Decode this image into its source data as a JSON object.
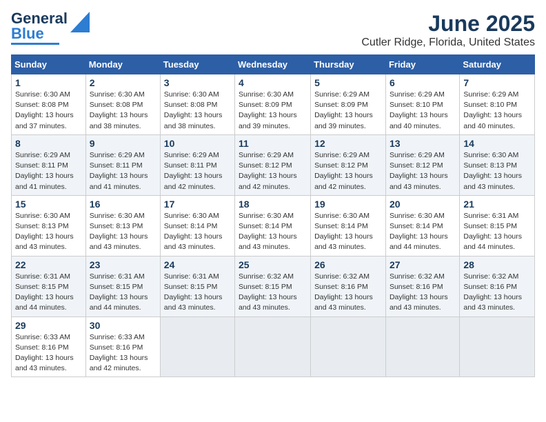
{
  "header": {
    "logo_general": "General",
    "logo_blue": "Blue",
    "month_year": "June 2025",
    "location": "Cutler Ridge, Florida, United States"
  },
  "days_of_week": [
    "Sunday",
    "Monday",
    "Tuesday",
    "Wednesday",
    "Thursday",
    "Friday",
    "Saturday"
  ],
  "weeks": [
    [
      {
        "day": "1",
        "sunrise": "6:30 AM",
        "sunset": "8:08 PM",
        "daylight": "13 hours and 37 minutes."
      },
      {
        "day": "2",
        "sunrise": "6:30 AM",
        "sunset": "8:08 PM",
        "daylight": "13 hours and 38 minutes."
      },
      {
        "day": "3",
        "sunrise": "6:30 AM",
        "sunset": "8:08 PM",
        "daylight": "13 hours and 38 minutes."
      },
      {
        "day": "4",
        "sunrise": "6:30 AM",
        "sunset": "8:09 PM",
        "daylight": "13 hours and 39 minutes."
      },
      {
        "day": "5",
        "sunrise": "6:29 AM",
        "sunset": "8:09 PM",
        "daylight": "13 hours and 39 minutes."
      },
      {
        "day": "6",
        "sunrise": "6:29 AM",
        "sunset": "8:10 PM",
        "daylight": "13 hours and 40 minutes."
      },
      {
        "day": "7",
        "sunrise": "6:29 AM",
        "sunset": "8:10 PM",
        "daylight": "13 hours and 40 minutes."
      }
    ],
    [
      {
        "day": "8",
        "sunrise": "6:29 AM",
        "sunset": "8:11 PM",
        "daylight": "13 hours and 41 minutes."
      },
      {
        "day": "9",
        "sunrise": "6:29 AM",
        "sunset": "8:11 PM",
        "daylight": "13 hours and 41 minutes."
      },
      {
        "day": "10",
        "sunrise": "6:29 AM",
        "sunset": "8:11 PM",
        "daylight": "13 hours and 42 minutes."
      },
      {
        "day": "11",
        "sunrise": "6:29 AM",
        "sunset": "8:12 PM",
        "daylight": "13 hours and 42 minutes."
      },
      {
        "day": "12",
        "sunrise": "6:29 AM",
        "sunset": "8:12 PM",
        "daylight": "13 hours and 42 minutes."
      },
      {
        "day": "13",
        "sunrise": "6:29 AM",
        "sunset": "8:12 PM",
        "daylight": "13 hours and 43 minutes."
      },
      {
        "day": "14",
        "sunrise": "6:30 AM",
        "sunset": "8:13 PM",
        "daylight": "13 hours and 43 minutes."
      }
    ],
    [
      {
        "day": "15",
        "sunrise": "6:30 AM",
        "sunset": "8:13 PM",
        "daylight": "13 hours and 43 minutes."
      },
      {
        "day": "16",
        "sunrise": "6:30 AM",
        "sunset": "8:13 PM",
        "daylight": "13 hours and 43 minutes."
      },
      {
        "day": "17",
        "sunrise": "6:30 AM",
        "sunset": "8:14 PM",
        "daylight": "13 hours and 43 minutes."
      },
      {
        "day": "18",
        "sunrise": "6:30 AM",
        "sunset": "8:14 PM",
        "daylight": "13 hours and 43 minutes."
      },
      {
        "day": "19",
        "sunrise": "6:30 AM",
        "sunset": "8:14 PM",
        "daylight": "13 hours and 43 minutes."
      },
      {
        "day": "20",
        "sunrise": "6:30 AM",
        "sunset": "8:14 PM",
        "daylight": "13 hours and 44 minutes."
      },
      {
        "day": "21",
        "sunrise": "6:31 AM",
        "sunset": "8:15 PM",
        "daylight": "13 hours and 44 minutes."
      }
    ],
    [
      {
        "day": "22",
        "sunrise": "6:31 AM",
        "sunset": "8:15 PM",
        "daylight": "13 hours and 44 minutes."
      },
      {
        "day": "23",
        "sunrise": "6:31 AM",
        "sunset": "8:15 PM",
        "daylight": "13 hours and 44 minutes."
      },
      {
        "day": "24",
        "sunrise": "6:31 AM",
        "sunset": "8:15 PM",
        "daylight": "13 hours and 43 minutes."
      },
      {
        "day": "25",
        "sunrise": "6:32 AM",
        "sunset": "8:15 PM",
        "daylight": "13 hours and 43 minutes."
      },
      {
        "day": "26",
        "sunrise": "6:32 AM",
        "sunset": "8:16 PM",
        "daylight": "13 hours and 43 minutes."
      },
      {
        "day": "27",
        "sunrise": "6:32 AM",
        "sunset": "8:16 PM",
        "daylight": "13 hours and 43 minutes."
      },
      {
        "day": "28",
        "sunrise": "6:32 AM",
        "sunset": "8:16 PM",
        "daylight": "13 hours and 43 minutes."
      }
    ],
    [
      {
        "day": "29",
        "sunrise": "6:33 AM",
        "sunset": "8:16 PM",
        "daylight": "13 hours and 43 minutes."
      },
      {
        "day": "30",
        "sunrise": "6:33 AM",
        "sunset": "8:16 PM",
        "daylight": "13 hours and 42 minutes."
      },
      {
        "day": "",
        "sunrise": "",
        "sunset": "",
        "daylight": ""
      },
      {
        "day": "",
        "sunrise": "",
        "sunset": "",
        "daylight": ""
      },
      {
        "day": "",
        "sunrise": "",
        "sunset": "",
        "daylight": ""
      },
      {
        "day": "",
        "sunrise": "",
        "sunset": "",
        "daylight": ""
      },
      {
        "day": "",
        "sunrise": "",
        "sunset": "",
        "daylight": ""
      }
    ]
  ]
}
